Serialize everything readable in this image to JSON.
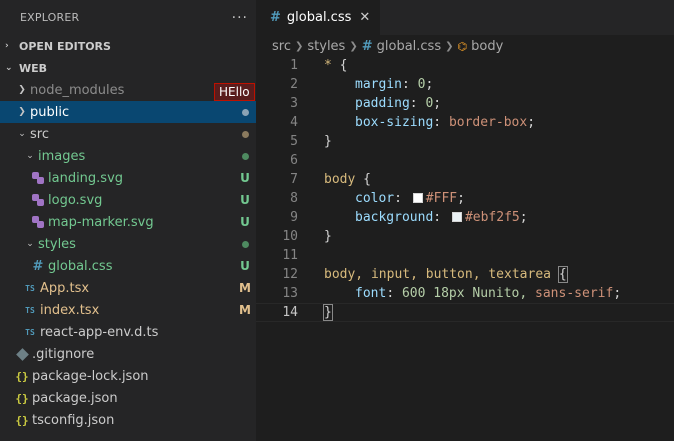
{
  "sidebar": {
    "title": "EXPLORER",
    "more": "···",
    "sections": [
      {
        "label": "OPEN EDITORS",
        "chevron": "›"
      },
      {
        "label": "WEB",
        "chevron": "⌄"
      }
    ],
    "items": [
      {
        "label": "node_modules",
        "status": ""
      },
      {
        "label": "public",
        "status": ""
      },
      {
        "label": "src",
        "status": ""
      },
      {
        "label": "images",
        "status": ""
      },
      {
        "label": "landing.svg",
        "status": "U"
      },
      {
        "label": "logo.svg",
        "status": "U"
      },
      {
        "label": "map-marker.svg",
        "status": "U"
      },
      {
        "label": "styles",
        "status": ""
      },
      {
        "label": "global.css",
        "status": "U"
      },
      {
        "label": "App.tsx",
        "status": "M"
      },
      {
        "label": "index.tsx",
        "status": "M"
      },
      {
        "label": "react-app-env.d.ts",
        "status": ""
      },
      {
        "label": ".gitignore",
        "status": ""
      },
      {
        "label": "package-lock.json",
        "status": ""
      },
      {
        "label": "package.json",
        "status": ""
      },
      {
        "label": "tsconfig.json",
        "status": ""
      }
    ],
    "icon_text": {
      "ts": "TS",
      "hash": "#",
      "braces": "{}"
    },
    "tooltip": "HEllo"
  },
  "editor": {
    "tab": {
      "hash": "#",
      "label": "global.css",
      "close": "✕"
    },
    "breadcrumb": [
      "src",
      "styles",
      "global.css",
      "body"
    ],
    "breadcrumb_hash": "#",
    "breadcrumb_symbol": "⌬",
    "line_numbers": [
      "1",
      "2",
      "3",
      "4",
      "5",
      "6",
      "7",
      "8",
      "9",
      "10",
      "11",
      "12",
      "13",
      "14"
    ],
    "code": {
      "l1_sel": "* ",
      "l1_brace": "{",
      "l2_prop": "margin",
      "l2_val": "0",
      "l3_prop": "padding",
      "l3_val": "0",
      "l4_prop": "box-sizing",
      "l4_val": "border-box",
      "l5": "}",
      "l7_sel": "body ",
      "l7_brace": "{",
      "l8_prop": "color",
      "l8_val": "#FFF",
      "l9_prop": "background",
      "l9_val": "#ebf2f5",
      "l10": "}",
      "l12_sel": "body, input, button, textarea ",
      "l12_brace": "{",
      "l13_prop": "font",
      "l13_val": "600 18px Nunito, ",
      "l13_str": "sans-serif",
      "l14": "}",
      "colon": ": ",
      "semi": ";"
    }
  },
  "colors": {
    "swatch_white": "#FFFFFF",
    "swatch_ebf2f5": "#ebf2f5",
    "selected_row": "#094771",
    "untracked": "#73c991",
    "modified": "#e2c08d"
  }
}
